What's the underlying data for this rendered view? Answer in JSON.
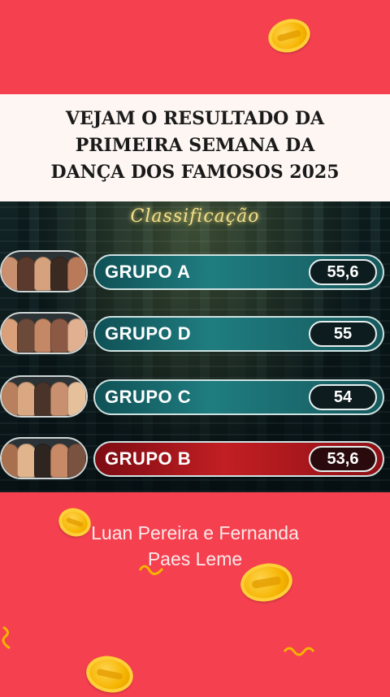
{
  "header": {
    "title_lines": [
      "VEJAM O RESULTADO DA",
      "PRIMEIRA SEMANA DA",
      "DANÇA DOS FAMOSOS 2025"
    ]
  },
  "ranking": {
    "heading": "Classificação",
    "rows": [
      {
        "group": "GRUPO A",
        "score": "55,6",
        "highlight": false
      },
      {
        "group": "GRUPO D",
        "score": "55",
        "highlight": false
      },
      {
        "group": "GRUPO C",
        "score": "54",
        "highlight": false
      },
      {
        "group": "GRUPO B",
        "score": "53,6",
        "highlight": true
      }
    ]
  },
  "caption": {
    "line1": "Luan Pereira e Fernanda",
    "line2": "Paes Leme"
  },
  "colors": {
    "background": "#f4404f",
    "title_band": "#fdf6f2",
    "teal_bar": "#1f7d80",
    "red_bar": "#c21f23",
    "coin": "#f5b400"
  }
}
